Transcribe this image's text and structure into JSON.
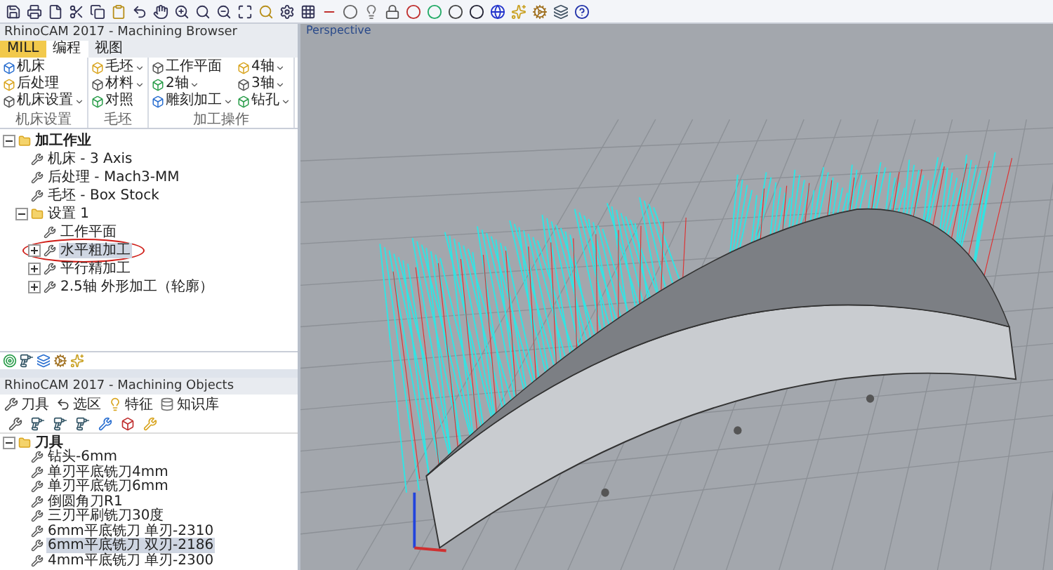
{
  "machining_browser": {
    "title": "RhinoCAM 2017 - Machining Browser",
    "tabs": [
      {
        "label": "MILL",
        "selected": false
      },
      {
        "label": "编程",
        "selected": true
      },
      {
        "label": "视图",
        "selected": false
      }
    ],
    "ribbon_groups": [
      {
        "label": "机床设置",
        "items": [
          {
            "label": "机床",
            "dropdown": false
          },
          {
            "label": "后处理",
            "dropdown": false
          },
          {
            "label": "机床设置",
            "dropdown": true
          }
        ]
      },
      {
        "label": "毛坯",
        "items": [
          {
            "label": "毛坯",
            "dropdown": true
          },
          {
            "label": "材料",
            "dropdown": true
          },
          {
            "label": "对照",
            "dropdown": false
          }
        ]
      },
      {
        "label": "加工操作",
        "items": [
          {
            "label": "工作平面",
            "dropdown": false
          },
          {
            "label": "2轴",
            "dropdown": true
          },
          {
            "label": "雕刻加工",
            "dropdown": true
          },
          {
            "label": "4轴",
            "dropdown": true
          },
          {
            "label": "3轴",
            "dropdown": true
          },
          {
            "label": "钻孔",
            "dropdown": true
          }
        ]
      }
    ],
    "tree": [
      {
        "label": "加工作业",
        "expanded": true,
        "selected": false,
        "circled": false,
        "children": [
          {
            "label": "机床 - 3 Axis",
            "selected": false,
            "circled": false
          },
          {
            "label": "后处理 - Mach3-MM",
            "selected": false,
            "circled": false
          },
          {
            "label": "毛坯 - Box Stock",
            "selected": false,
            "circled": false
          },
          {
            "label": "设置 1",
            "expanded": true,
            "selected": false,
            "circled": false,
            "children": [
              {
                "label": "工作平面",
                "selected": false,
                "circled": false
              },
              {
                "label": "水平粗加工",
                "expanded": false,
                "selected": true,
                "circled": true
              },
              {
                "label": "平行精加工",
                "expanded": false,
                "selected": false,
                "circled": false
              },
              {
                "label": "2.5轴 外形加工（轮廓）",
                "expanded": false,
                "selected": false,
                "circled": false
              }
            ]
          }
        ]
      }
    ]
  },
  "viewport": {
    "tab": "Perspective"
  },
  "machining_objects": {
    "title": "RhinoCAM 2017 - Machining Objects",
    "toolbar": [
      {
        "label": "刀具"
      },
      {
        "label": "选区"
      },
      {
        "label": "特征"
      },
      {
        "label": "知识库"
      }
    ],
    "tree": [
      {
        "label": "刀具",
        "expanded": true,
        "selected": false,
        "children": [
          {
            "label": "钻头-6mm",
            "selected": false
          },
          {
            "label": "单刃平底铣刀4mm",
            "selected": false
          },
          {
            "label": "单刃平底铣刀6mm",
            "selected": false
          },
          {
            "label": "倒圆角刀R1",
            "selected": false
          },
          {
            "label": "三刃平刷铣刀30度",
            "selected": false
          },
          {
            "label": "6mm平底铣刀 单刃-2310",
            "selected": false
          },
          {
            "label": "6mm平底铣刀 双刃-2186",
            "selected": true
          },
          {
            "label": "4mm平底铣刀 单刃-2300",
            "selected": false
          }
        ]
      }
    ]
  }
}
